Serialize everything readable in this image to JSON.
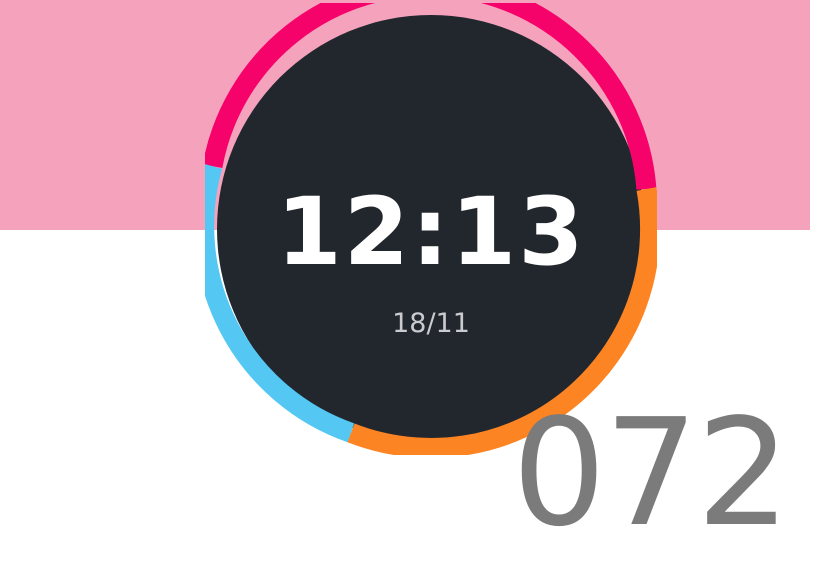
{
  "watch_face": {
    "time": "12:13",
    "date": "18/11",
    "colors": {
      "face": "#22272d",
      "arc_top": "#f5036a",
      "arc_right": "#fd8422",
      "arc_left": "#54c8f3",
      "background_band": "#f5a3bd"
    }
  },
  "overlay": {
    "number": "072"
  }
}
